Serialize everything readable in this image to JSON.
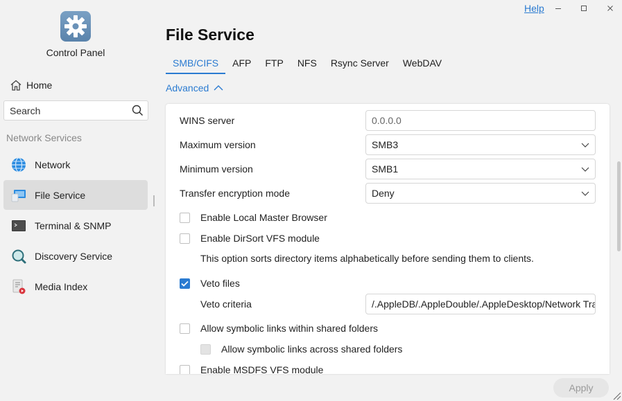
{
  "app": {
    "title": "Control Panel",
    "logo_icon": "gear-icon",
    "help_label": "Help",
    "window_controls": [
      "minimize-icon",
      "maximize-icon",
      "close-icon"
    ]
  },
  "sidebar": {
    "home_label": "Home",
    "search_placeholder": "Search",
    "section_label": "Network Services",
    "items": [
      {
        "label": "Network",
        "icon": "globe-icon",
        "active": false
      },
      {
        "label": "File Service",
        "icon": "file-service-icon",
        "active": true
      },
      {
        "label": "Terminal & SNMP",
        "icon": "terminal-icon",
        "active": false
      },
      {
        "label": "Discovery Service",
        "icon": "magnifier-icon",
        "active": false
      },
      {
        "label": "Media Index",
        "icon": "media-index-icon",
        "active": false
      }
    ]
  },
  "main": {
    "title": "File Service",
    "tabs": [
      {
        "label": "SMB/CIFS",
        "active": true
      },
      {
        "label": "AFP",
        "active": false
      },
      {
        "label": "FTP",
        "active": false
      },
      {
        "label": "NFS",
        "active": false
      },
      {
        "label": "Rsync Server",
        "active": false
      },
      {
        "label": "WebDAV",
        "active": false
      }
    ],
    "advanced_label": "Advanced",
    "settings": {
      "wins_server": {
        "label": "WINS server",
        "value": "0.0.0.0"
      },
      "max_version": {
        "label": "Maximum version",
        "value": "SMB3"
      },
      "min_version": {
        "label": "Minimum version",
        "value": "SMB1"
      },
      "encryption": {
        "label": "Transfer encryption mode",
        "value": "Deny"
      },
      "local_master": {
        "label": "Enable Local Master Browser",
        "checked": false
      },
      "dirsort": {
        "label": "Enable DirSort VFS module",
        "checked": false,
        "description": "This option sorts directory items alphabetically before sending them to clients."
      },
      "veto_files": {
        "label": "Veto files",
        "checked": true
      },
      "veto_criteria": {
        "label": "Veto criteria",
        "value": "/.AppleDB/.AppleDouble/.AppleDesktop/Network Trash Folder/"
      },
      "symlinks_within": {
        "label": "Allow symbolic links within shared folders",
        "checked": false
      },
      "symlinks_across": {
        "label": "Allow symbolic links across shared folders",
        "checked": false,
        "disabled": true
      },
      "msdfs": {
        "label": "Enable MSDFS VFS module",
        "checked": false
      }
    },
    "apply_label": "Apply"
  },
  "colors": {
    "accent": "#2b7bd1",
    "active_nav": "#dddddd"
  }
}
